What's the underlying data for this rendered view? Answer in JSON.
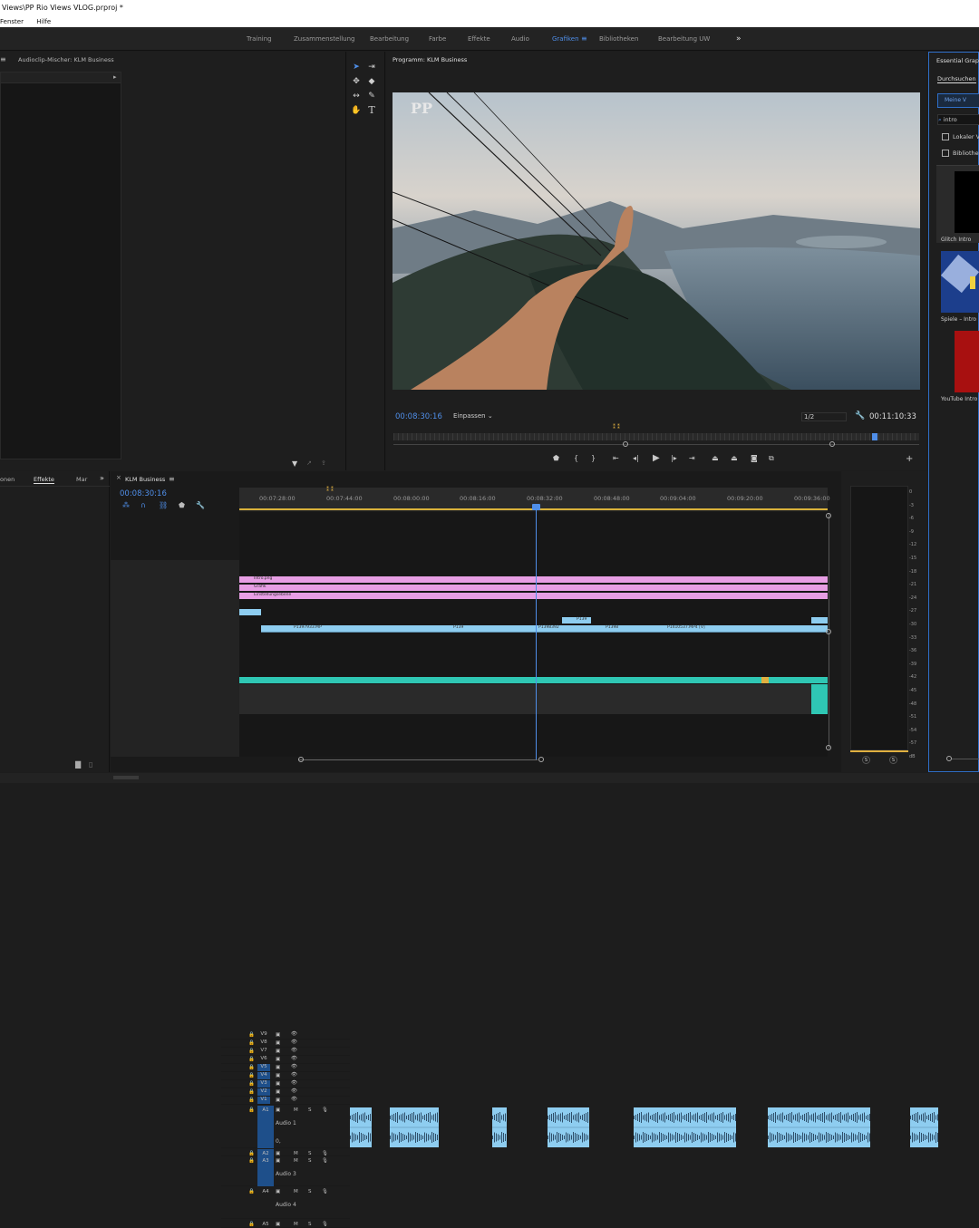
{
  "window": {
    "title": "Views\\PP Rio Views VLOG.prproj *"
  },
  "menu": {
    "items": [
      "Fenster",
      "Hilfe"
    ]
  },
  "workspaces": {
    "tabs": [
      "Training",
      "Zusammenstellung",
      "Bearbeitung",
      "Farbe",
      "Effekte",
      "Audio",
      "Grafiken",
      "Bibliotheken",
      "Bearbeitung UW"
    ],
    "active": "Grafiken",
    "more": "»"
  },
  "audio_mixer": {
    "title": "Audioclip-Mischer: KLM Business"
  },
  "program": {
    "title": "Programm: KLM Business",
    "timecode": "00:08:30:16",
    "fit": "Einpassen",
    "resolution": "1/2",
    "duration": "00:11:10:33",
    "logo_text": "PP"
  },
  "essential_graphics": {
    "title": "Essential Graphi",
    "tab_browse": "Durchsuchen",
    "button": "Meine V",
    "search_value": "intro",
    "checkbox_local": "Lokaler Vo",
    "checkbox_libs": "Bibliothek",
    "items": [
      {
        "label": "Glitch Intro"
      },
      {
        "label": "Spiele – Intro"
      },
      {
        "label": "YouTube Intro"
      }
    ]
  },
  "effects_panel": {
    "tabs": [
      "onen",
      "Effekte",
      "Mar"
    ],
    "more": "»"
  },
  "timeline": {
    "title": "KLM Business",
    "timecode": "00:08:30:16",
    "ruler": [
      "00:07:28:00",
      "00:07:44:00",
      "00:08:00:00",
      "00:08:16:00",
      "00:08:32:00",
      "00:08:48:00",
      "00:09:04:00",
      "00:09:20:00",
      "00:09:36:00"
    ],
    "video_tracks": [
      "V9",
      "V8",
      "V7",
      "V6",
      "V5",
      "V4",
      "V3",
      "V2",
      "V1"
    ],
    "audio_tracks": [
      {
        "id": "A1",
        "name": "Audio 1"
      },
      {
        "id": "A2",
        "name": ""
      },
      {
        "id": "A3",
        "name": "Audio 3"
      },
      {
        "id": "A4",
        "name": "Audio 4"
      },
      {
        "id": "A5",
        "name": ""
      }
    ],
    "track_buttons": {
      "mute": "M",
      "solo": "S"
    },
    "clips": {
      "v7": "Intro.png",
      "v6": "Grafik",
      "v5": "Einstellungsebene",
      "v2": "P139",
      "v1": [
        "P1397933.MP",
        "P139",
        "P1398392",
        "P1398",
        "P1410537.MP4 [V]"
      ]
    },
    "audio_ctrl": "0,"
  },
  "meter": {
    "scale": [
      "0",
      "-3",
      "-6",
      "-9",
      "-12",
      "-15",
      "-18",
      "-21",
      "-24",
      "-27",
      "-30",
      "-33",
      "-36",
      "-39",
      "-42",
      "-45",
      "-48",
      "-51",
      "-54",
      "-57",
      "dB"
    ],
    "solo": [
      "S",
      "S"
    ]
  },
  "colors": {
    "accent": "#4f8ee8",
    "pink_clip": "#e79ee4",
    "blue_clip": "#8ecdf0",
    "teal_audio": "#2fc7b4"
  }
}
